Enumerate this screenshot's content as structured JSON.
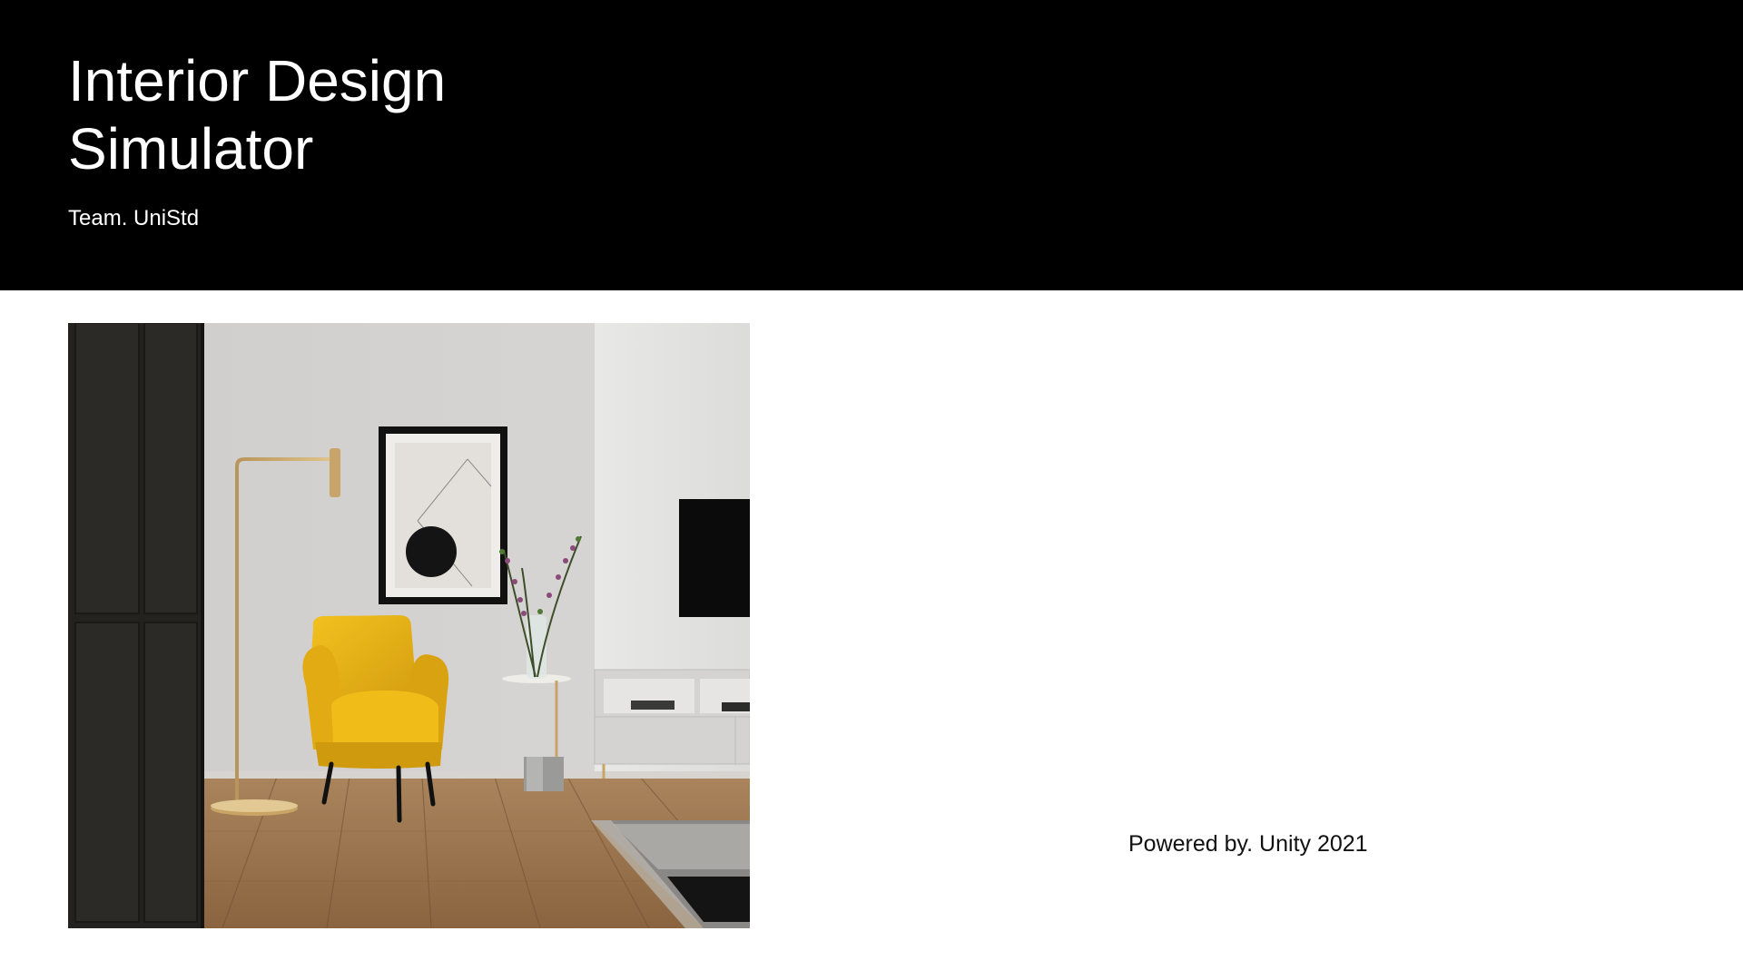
{
  "slide": {
    "title": "Interior Design Simulator",
    "team": "Team. UniStd",
    "powered_by": "Powered by. Unity 2021"
  },
  "hero_image": {
    "subject": "living-room-interior",
    "elements": [
      "dark-wardrobe",
      "brass-floor-lamp",
      "framed-art",
      "yellow-armchair",
      "side-table-vase",
      "wall-tv",
      "tv-console",
      "rug",
      "wood-floor"
    ]
  },
  "colors": {
    "header_bg": "#000000",
    "page_bg": "#ffffff",
    "header_text": "#ffffff",
    "body_text": "#111111",
    "armchair": "#e8b21c"
  }
}
